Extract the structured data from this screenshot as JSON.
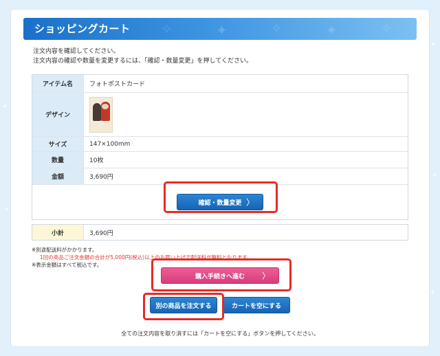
{
  "header": {
    "title": "ショッピングカート"
  },
  "intro": {
    "line1": "注文内容を確認してください。",
    "line2": "注文内容の確認や数量を変更するには、「確認・数量変更」を押してください。"
  },
  "order": {
    "rows": [
      {
        "label": "アイテム名",
        "value": "フォトポストカード"
      },
      {
        "label": "デザイン",
        "value": ""
      },
      {
        "label": "サイズ",
        "value": "147×100mm"
      },
      {
        "label": "数量",
        "value": "10枚"
      },
      {
        "label": "金額",
        "value": "3,690円"
      }
    ],
    "confirm_button": "確認・数量変更"
  },
  "subtotal": {
    "label": "小計",
    "value": "3,690円"
  },
  "notes": {
    "line1": "※別途配送料がかかります。",
    "line2": "1回の商品ご注文金額の合計が5,000円(税込)以上のお買い上げで配送料が無料となります。",
    "line3": "※表示金額はすべて税込です。"
  },
  "actions": {
    "checkout_button": "購入手続きへ進む",
    "order_other_button": "別の商品を注文する",
    "empty_cart_button": "カートを空にする"
  },
  "footer": {
    "note": "全ての注文内容を取り消すには「カートを空にする」ボタンを押してください。"
  },
  "colors": {
    "accent_blue": "#1a70c9",
    "checkout_pink": "#e24e89",
    "highlight_red": "#e52b22"
  }
}
